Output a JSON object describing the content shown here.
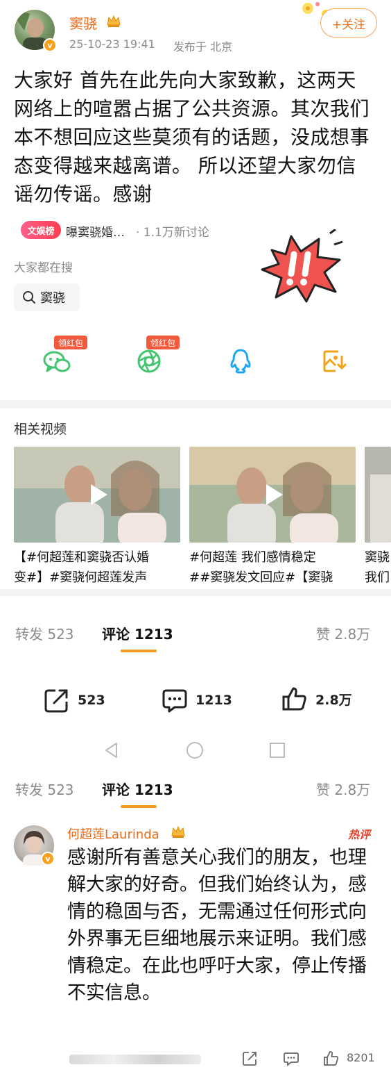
{
  "post": {
    "author": "窦骁",
    "time": "25-10-23 19:41",
    "location": "发布于 北京",
    "follow_label": "+关注",
    "text": "大家好 首先在此先向大家致歉，这两天网络上的喧嚣占据了公共资源。其次我们本不想回应这些莫须有的话题，没成想事态变得越来越离谱。 所以还望大家勿信谣勿传谣。感谢",
    "hot_tag": "文娱榜",
    "hot_topic": "曝窦骁婚…",
    "hot_count": "· 1.1万新讨论",
    "search_label": "大家都在搜",
    "search_chip": "窦骁",
    "badge_letter": "v"
  },
  "share": {
    "redpack_label": "领红包",
    "icons": [
      "wechat-icon",
      "moments-icon",
      "qq-icon",
      "save-image-icon"
    ]
  },
  "videos": {
    "title": "相关视频",
    "items": [
      {
        "line1": "【#何超莲和窦骁否认婚",
        "line2": "变#】#窦骁何超莲发声"
      },
      {
        "line1": "#何超莲 我们感情稳定",
        "line2": "##窦骁发文回应#【窦骁"
      },
      {
        "line1": "窦骁",
        "line2": "我们"
      }
    ]
  },
  "tabs": {
    "repost": "转发 523",
    "comment": "评论 1213",
    "like": "赞 2.8万"
  },
  "actions": {
    "repost": "523",
    "comment": "1213",
    "like": "2.8万"
  },
  "comment": {
    "author": "何超莲Laurinda",
    "hot_badge": "热评",
    "text": "感谢所有善意关心我们的朋友，也理解大家的好奇。但我们始终认为，感情的稳固与否，无需通过任何形式向外界事无巨细地展示来证明。我们感情稳定。在此也呼吁大家，停止传播不实信息。",
    "likes": "8201"
  },
  "colors": {
    "accent": "#e86b1c",
    "tab_underline": "#f59a23",
    "hot_red": "#e8432a"
  }
}
